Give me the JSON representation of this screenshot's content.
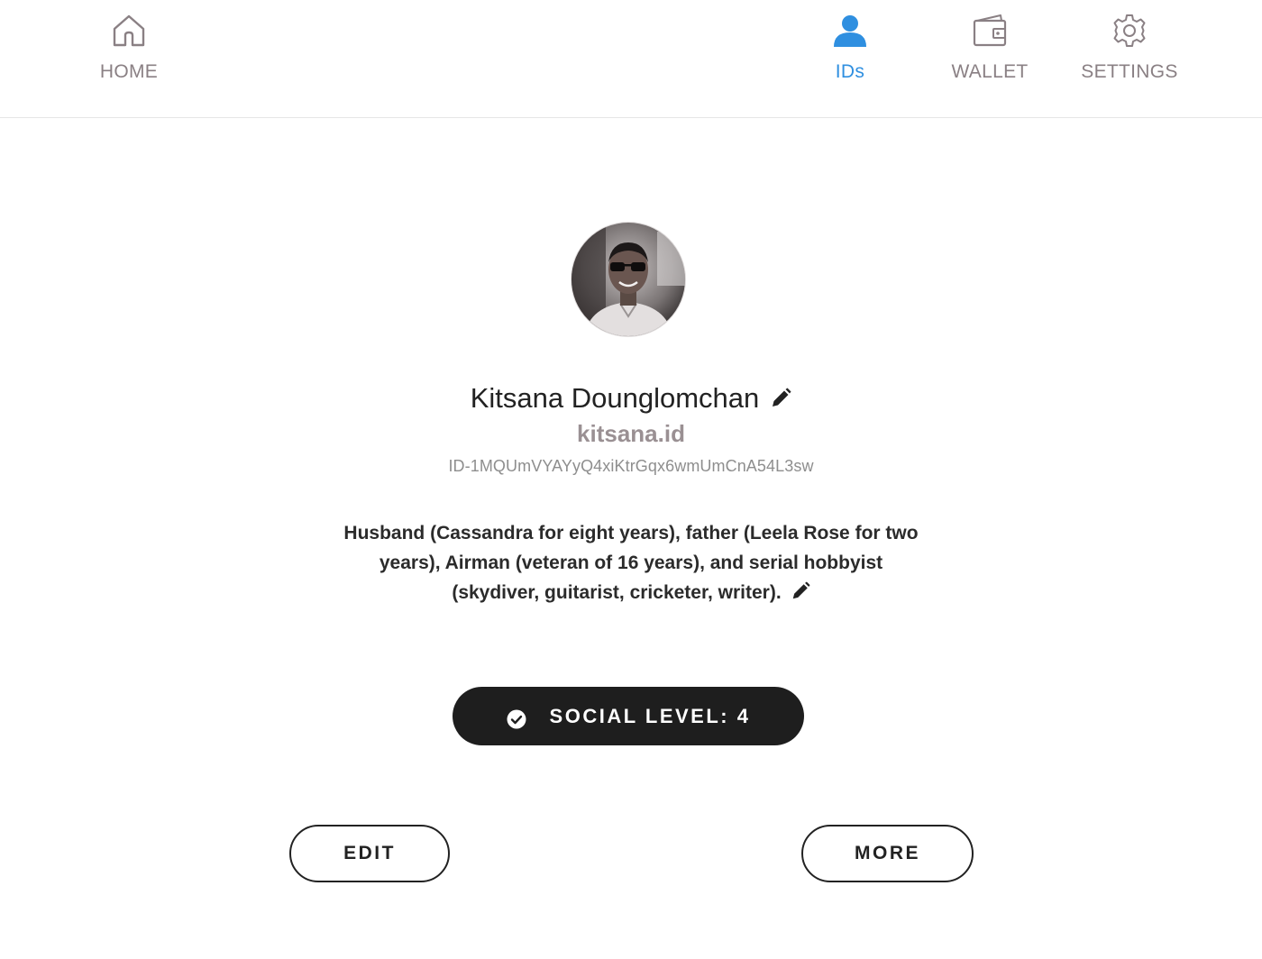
{
  "nav": {
    "items": [
      {
        "label": "HOME",
        "icon": "home-icon",
        "active": false
      },
      {
        "label": "IDs",
        "icon": "user-icon",
        "active": true
      },
      {
        "label": "WALLET",
        "icon": "wallet-icon",
        "active": false
      },
      {
        "label": "SETTINGS",
        "icon": "gear-icon",
        "active": false
      }
    ],
    "active_color": "#2f8fe0",
    "inactive_color": "#8a8084"
  },
  "profile": {
    "name": "Kitsana Dounglomchan",
    "handle": "kitsana.id",
    "id": "ID-1MQUmVYAYyQ4xiKtrGqx6wmUmCnA54L3sw",
    "bio": "Husband (Cassandra for eight years), father (Leela Rose for two years), Airman (veteran of 16 years), and serial hobbyist (skydiver, guitarist, cricketer, writer)."
  },
  "social": {
    "label": "SOCIAL LEVEL: 4",
    "icon": "check-circle-icon"
  },
  "actions": {
    "edit_label": "EDIT",
    "more_label": "MORE"
  }
}
